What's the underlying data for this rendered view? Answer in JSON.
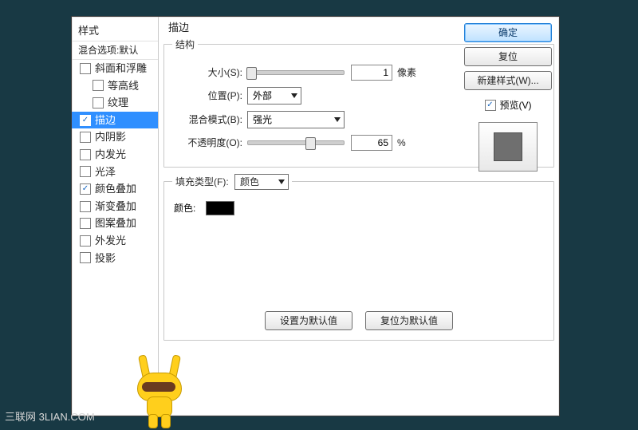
{
  "styles": {
    "header": "样式",
    "blend_header": "混合选项:默认",
    "items": [
      {
        "label": "斜面和浮雕",
        "checked": false,
        "indent": false,
        "selected": false
      },
      {
        "label": "等高线",
        "checked": false,
        "indent": true,
        "selected": false
      },
      {
        "label": "纹理",
        "checked": false,
        "indent": true,
        "selected": false
      },
      {
        "label": "描边",
        "checked": true,
        "indent": false,
        "selected": true
      },
      {
        "label": "内阴影",
        "checked": false,
        "indent": false,
        "selected": false
      },
      {
        "label": "内发光",
        "checked": false,
        "indent": false,
        "selected": false
      },
      {
        "label": "光泽",
        "checked": false,
        "indent": false,
        "selected": false
      },
      {
        "label": "颜色叠加",
        "checked": true,
        "indent": false,
        "selected": false
      },
      {
        "label": "渐变叠加",
        "checked": false,
        "indent": false,
        "selected": false
      },
      {
        "label": "图案叠加",
        "checked": false,
        "indent": false,
        "selected": false
      },
      {
        "label": "外发光",
        "checked": false,
        "indent": false,
        "selected": false
      },
      {
        "label": "投影",
        "checked": false,
        "indent": false,
        "selected": false
      }
    ]
  },
  "panel": {
    "title": "描边",
    "group1_legend": "结构",
    "size_label": "大小(S):",
    "size_value": "1",
    "size_unit": "像素",
    "position_label": "位置(P):",
    "position_value": "外部",
    "blend_label": "混合模式(B):",
    "blend_value": "强光",
    "opacity_label": "不透明度(O):",
    "opacity_value": "65",
    "opacity_unit": "%",
    "group2_legend_prefix": "填充类型(F):",
    "fill_type_value": "颜色",
    "color_label": "颜色:",
    "color_value": "#000000",
    "set_default_btn": "设置为默认值",
    "reset_default_btn": "复位为默认值"
  },
  "right": {
    "ok": "确定",
    "reset": "复位",
    "new_style": "新建样式(W)...",
    "preview_label": "预览(V)",
    "preview_checked": true
  },
  "watermark": "三联网 3LIAN.COM"
}
